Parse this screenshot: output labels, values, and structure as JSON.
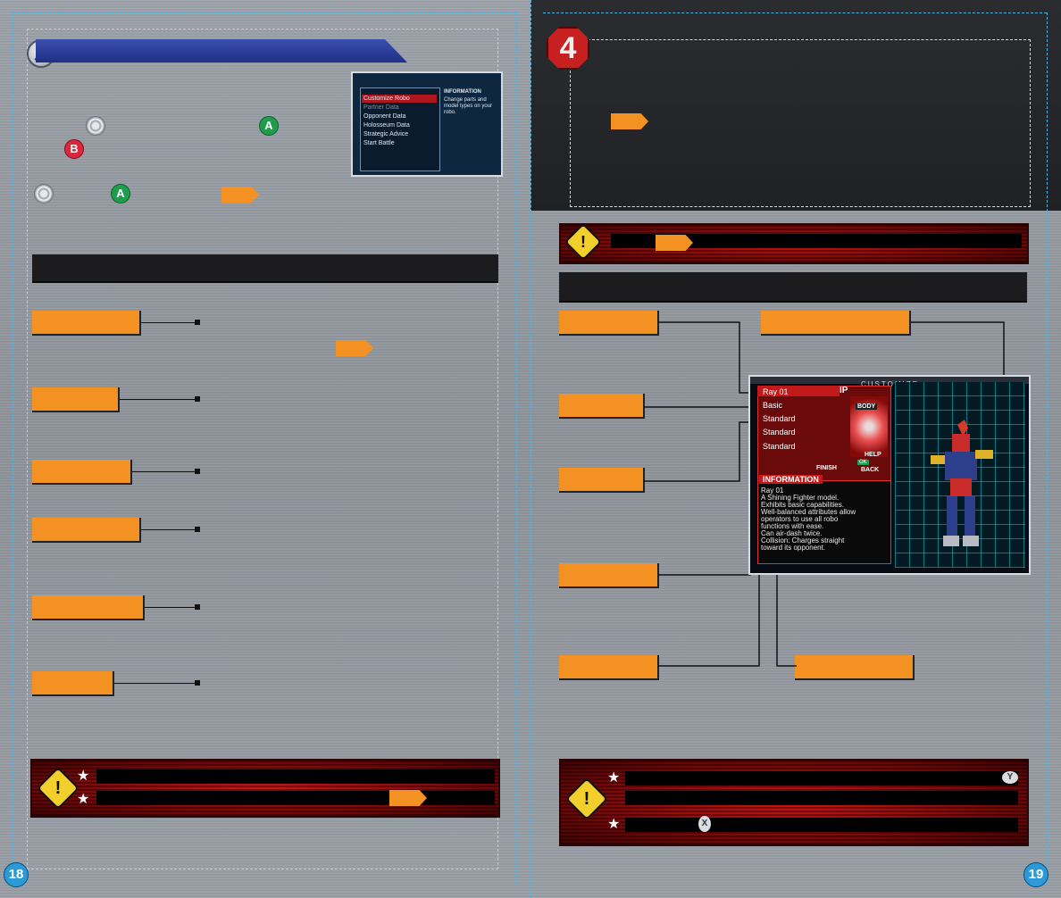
{
  "left_page": {
    "page_number": "18",
    "menu_screenshot": {
      "items": [
        "Customize Robo",
        "Partner Data",
        "Opponent Data",
        "Holosseum Data",
        "Strategic Advice",
        "Start Battle"
      ],
      "info_title": "INFORMATION",
      "info_text": "Change parts and model types on your robo."
    },
    "buttons": {
      "a": "A",
      "b": "B"
    }
  },
  "right_page": {
    "page_number": "19",
    "section_number": "4",
    "customize_screenshot": {
      "header": "CUSTOMIZE",
      "ip_label": "IP",
      "rows": [
        "Ray 01",
        "Basic",
        "Standard",
        "Standard",
        "Standard"
      ],
      "body_label": "BODY",
      "help_label": "HELP",
      "ok_label": "OK",
      "finish_label": "FINISH",
      "back_label": "BACK",
      "info_title": "INFORMATION",
      "info_text": "Ray 01\nA Shining Fighter model.\nExhibits basic capabilities.\nWell-balanced attributes allow\noperators to use all robo\nfunctions with ease.\nCan air-dash twice.\nCollision: Charges straight\ntoward its opponent."
    },
    "buttons": {
      "y": "Y",
      "x": "X"
    }
  }
}
